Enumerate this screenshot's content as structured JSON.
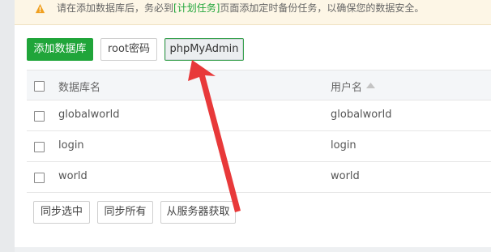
{
  "notice": {
    "text_before": "请在添加数据库后，务必到",
    "link": "[计划任务]",
    "text_after": "页面添加定时备份任务，以确保您的数据安全。",
    "icon": "warning-icon"
  },
  "toolbar": {
    "add_db_label": "添加数据库",
    "root_pwd_label": "root密码",
    "phpmyadmin_label": "phpMyAdmin"
  },
  "table": {
    "headers": {
      "name": "数据库名",
      "user": "用户名"
    },
    "rows": [
      {
        "name": "globalworld",
        "user": "globalworld"
      },
      {
        "name": "login",
        "user": "login"
      },
      {
        "name": "world",
        "user": "world"
      }
    ]
  },
  "footer": {
    "sync_selected_label": "同步选中",
    "sync_all_label": "同步所有",
    "fetch_from_server_label": "从服务器获取"
  },
  "colors": {
    "accent_green": "#20a53a",
    "arrow_red": "#e8393a",
    "notice_bg": "#fdf6e6"
  }
}
